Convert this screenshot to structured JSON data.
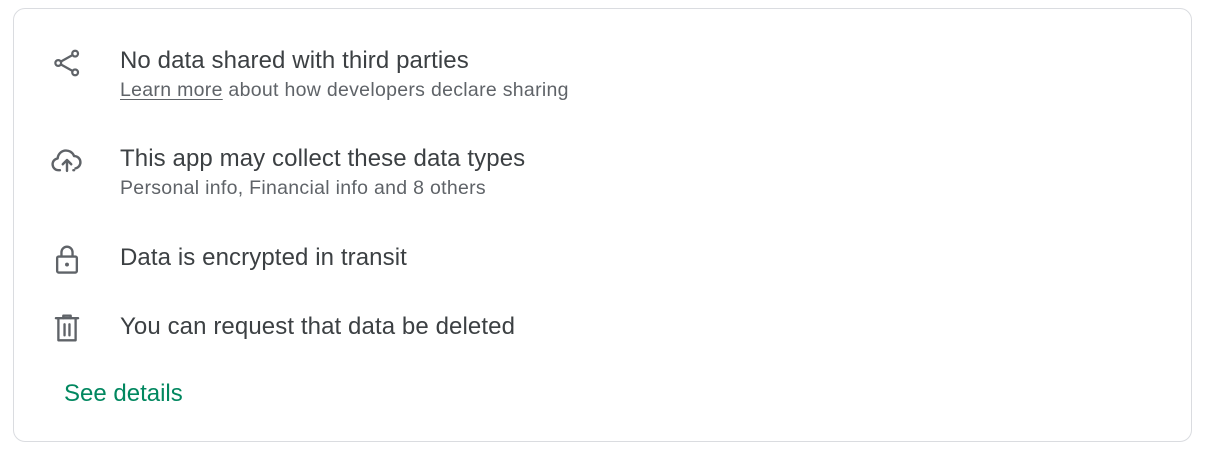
{
  "items": [
    {
      "icon": "share-icon",
      "title": "No data shared with third parties",
      "subtitle_link": "Learn more",
      "subtitle_rest": " about how developers declare sharing"
    },
    {
      "icon": "cloud-upload-icon",
      "title": "This app may collect these data types",
      "subtitle": "Personal info, Financial info and 8 others"
    },
    {
      "icon": "lock-icon",
      "title": "Data is encrypted in transit"
    },
    {
      "icon": "trash-icon",
      "title": "You can request that data be deleted"
    }
  ],
  "see_details_label": "See details",
  "colors": {
    "text_primary": "#3c4043",
    "text_secondary": "#5f6368",
    "accent": "#01875f",
    "border": "#dadce0"
  }
}
